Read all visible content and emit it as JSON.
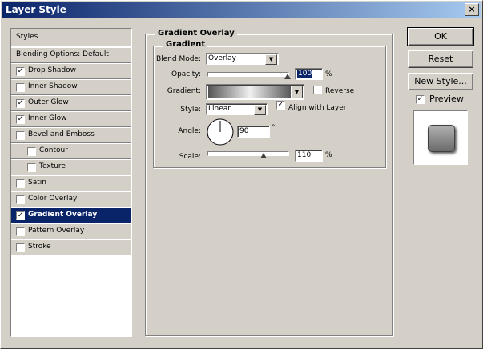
{
  "window": {
    "title": "Layer Style",
    "close_glyph": "×"
  },
  "left_panel": {
    "items": [
      {
        "label": "Styles",
        "checkable": false,
        "checked": false
      },
      {
        "label": "Blending Options: Default",
        "checkable": false,
        "checked": false
      },
      {
        "label": "Drop Shadow",
        "checkable": true,
        "checked": true
      },
      {
        "label": "Inner Shadow",
        "checkable": true,
        "checked": false
      },
      {
        "label": "Outer Glow",
        "checkable": true,
        "checked": true
      },
      {
        "label": "Inner Glow",
        "checkable": true,
        "checked": true
      },
      {
        "label": "Bevel and Emboss",
        "checkable": true,
        "checked": false
      },
      {
        "label": "Contour",
        "checkable": true,
        "checked": false
      },
      {
        "label": "Texture",
        "checkable": true,
        "checked": false
      },
      {
        "label": "Satin",
        "checkable": true,
        "checked": false
      },
      {
        "label": "Color Overlay",
        "checkable": true,
        "checked": false
      },
      {
        "label": "Gradient Overlay",
        "checkable": true,
        "checked": true,
        "selected": true
      },
      {
        "label": "Pattern Overlay",
        "checkable": true,
        "checked": false
      },
      {
        "label": "Stroke",
        "checkable": true,
        "checked": false
      }
    ]
  },
  "gradient_overlay": {
    "section_title": "Gradient Overlay",
    "group_title": "Gradient",
    "blend_mode_label": "Blend Mode:",
    "blend_mode_value": "Overlay",
    "opacity_label": "Opacity:",
    "opacity_value": "100",
    "opacity_fraction": 1.0,
    "percent": "%",
    "gradient_label": "Gradient:",
    "reverse_label": "Reverse",
    "reverse_checked": false,
    "style_label": "Style:",
    "style_value": "Linear",
    "align_label": "Align with Layer",
    "align_checked": true,
    "angle_label": "Angle:",
    "angle_value": "90",
    "degree": "°",
    "scale_label": "Scale:",
    "scale_value": "110",
    "scale_fraction": 0.7
  },
  "buttons": {
    "ok": "OK",
    "reset": "Reset",
    "new_style": "New Style...",
    "preview_label": "Preview",
    "preview_checked": true
  },
  "check_glyph": "✓",
  "arrow_glyph": "▼"
}
